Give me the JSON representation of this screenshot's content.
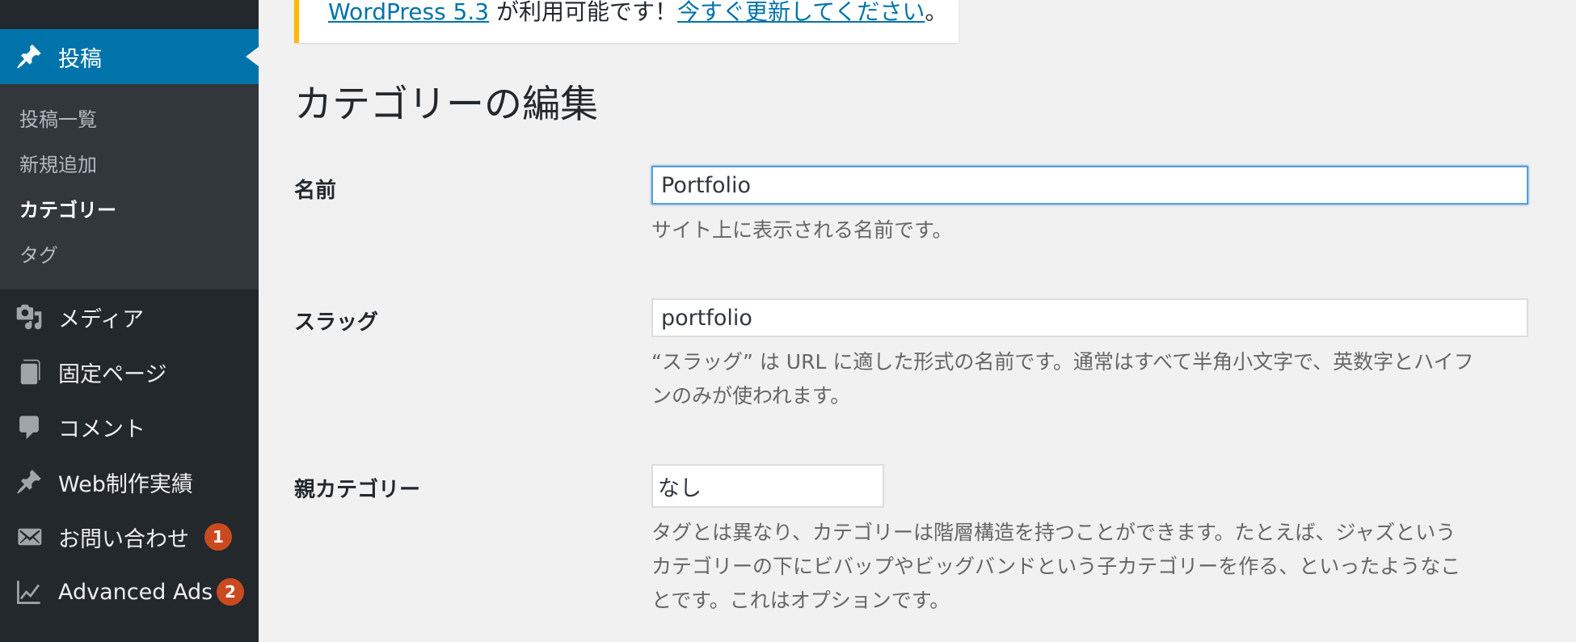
{
  "sidebar": {
    "current_menu": {
      "label": "投稿",
      "icon": "pin-icon"
    },
    "submenu": [
      {
        "label": "投稿一覧",
        "current": false
      },
      {
        "label": "新規追加",
        "current": false
      },
      {
        "label": "カテゴリー",
        "current": true
      },
      {
        "label": "タグ",
        "current": false
      }
    ],
    "menu": [
      {
        "label": "メディア",
        "icon": "media-icon"
      },
      {
        "label": "固定ページ",
        "icon": "pages-icon"
      },
      {
        "label": "コメント",
        "icon": "comment-icon"
      },
      {
        "label": "Web制作実績",
        "icon": "pin-icon"
      },
      {
        "label": "お問い合わせ",
        "icon": "mail-icon",
        "badge": "1"
      },
      {
        "label": "Advanced Ads",
        "icon": "chart-icon",
        "badge": "2"
      }
    ],
    "colors": {
      "background": "#23282d",
      "submenu_background": "#32373c",
      "current_background": "#0073aa",
      "badge": "#ca4a1f"
    }
  },
  "notice": {
    "link1": "WordPress 5.3",
    "text": " が利用可能です！",
    "link2": "今すぐ更新してください",
    "end": "。",
    "border_color": "#ffb900"
  },
  "page": {
    "title": "カテゴリーの編集"
  },
  "form": {
    "name": {
      "label": "名前",
      "value": "Portfolio",
      "description": "サイト上に表示される名前です。"
    },
    "slug": {
      "label": "スラッグ",
      "value": "portfolio",
      "description_line1": "“スラッグ” は URL に適した形式の名前です。通常はすべて半角小文字で、英数字とハイフ",
      "description_line2": "ンのみが使われます。"
    },
    "parent": {
      "label": "親カテゴリー",
      "selected": "なし",
      "description_line1": "タグとは異なり、カテゴリーは階層構造を持つことができます。たとえば、ジャズという",
      "description_line2": "カテゴリーの下にビバップやビッグバンドという子カテゴリーを作る、といったようなこ",
      "description_line3": "とです。これはオプションです。"
    }
  }
}
